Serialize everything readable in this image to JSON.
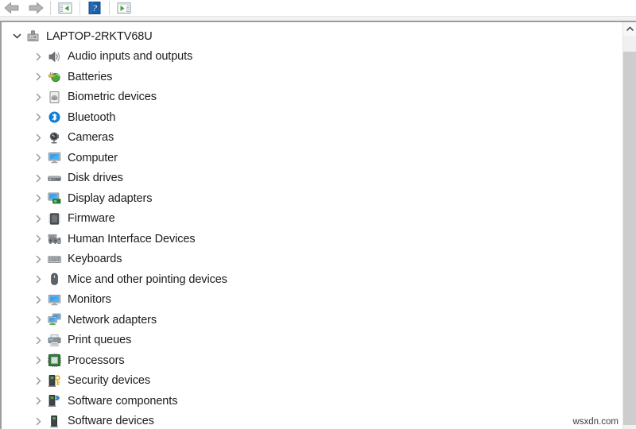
{
  "toolbar": {
    "buttons": [
      {
        "name": "back-button",
        "icon": "back-arrow-icon",
        "label": "Back"
      },
      {
        "name": "forward-button",
        "icon": "forward-arrow-icon",
        "label": "Forward"
      },
      {
        "name": "show-hide-tree-button",
        "icon": "show-hide-console-tree-icon",
        "label": "Show/Hide Console Tree"
      },
      {
        "name": "help-button",
        "icon": "help-question-icon",
        "label": "Help"
      },
      {
        "name": "properties-button",
        "icon": "properties-panel-icon",
        "label": "Properties"
      }
    ]
  },
  "tree": {
    "root": {
      "label": "LAPTOP-2RKTV68U",
      "icon": "computer-node-icon",
      "expanded": true,
      "chevron": "chevron-down-icon"
    },
    "items": [
      {
        "label": "Audio inputs and outputs",
        "icon": "speaker-icon",
        "chevron": "chevron-right-icon"
      },
      {
        "label": "Batteries",
        "icon": "battery-icon",
        "chevron": "chevron-right-icon"
      },
      {
        "label": "Biometric devices",
        "icon": "fingerprint-icon",
        "chevron": "chevron-right-icon"
      },
      {
        "label": "Bluetooth",
        "icon": "bluetooth-icon",
        "chevron": "chevron-right-icon"
      },
      {
        "label": "Cameras",
        "icon": "camera-icon",
        "chevron": "chevron-right-icon"
      },
      {
        "label": "Computer",
        "icon": "monitor-icon",
        "chevron": "chevron-right-icon"
      },
      {
        "label": "Disk drives",
        "icon": "disk-drive-icon",
        "chevron": "chevron-right-icon"
      },
      {
        "label": "Display adapters",
        "icon": "display-adapter-icon",
        "chevron": "chevron-right-icon"
      },
      {
        "label": "Firmware",
        "icon": "firmware-chip-icon",
        "chevron": "chevron-right-icon"
      },
      {
        "label": "Human Interface Devices",
        "icon": "hid-gamepad-icon",
        "chevron": "chevron-right-icon"
      },
      {
        "label": "Keyboards",
        "icon": "keyboard-icon",
        "chevron": "chevron-right-icon"
      },
      {
        "label": "Mice and other pointing devices",
        "icon": "mouse-icon",
        "chevron": "chevron-right-icon"
      },
      {
        "label": "Monitors",
        "icon": "monitor-screen-icon",
        "chevron": "chevron-right-icon"
      },
      {
        "label": "Network adapters",
        "icon": "network-adapter-icon",
        "chevron": "chevron-right-icon"
      },
      {
        "label": "Print queues",
        "icon": "printer-icon",
        "chevron": "chevron-right-icon"
      },
      {
        "label": "Processors",
        "icon": "processor-chip-icon",
        "chevron": "chevron-right-icon"
      },
      {
        "label": "Security devices",
        "icon": "security-key-icon",
        "chevron": "chevron-right-icon"
      },
      {
        "label": "Software components",
        "icon": "software-component-icon",
        "chevron": "chevron-right-icon"
      },
      {
        "label": "Software devices",
        "icon": "software-device-icon",
        "chevron": "chevron-right-icon"
      }
    ]
  },
  "scrollbar": {
    "up_arrow": "scroll-up-arrow-icon",
    "orientation": "vertical"
  },
  "watermark": {
    "text": "wsxdn.com"
  },
  "colors": {
    "accent_blue": "#0a84d8",
    "bluetooth_blue": "#0f7fd4",
    "green": "#3fa535",
    "key_yellow": "#e8b81e",
    "text": "#1b1b1b",
    "divider": "#9d9d9d",
    "scroll_thumb": "#cdcdcd"
  }
}
